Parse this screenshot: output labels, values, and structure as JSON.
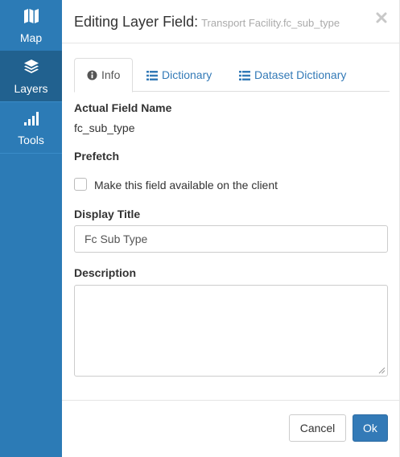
{
  "sidebar": {
    "items": [
      {
        "label": "Map",
        "icon": "map-icon"
      },
      {
        "label": "Layers",
        "icon": "layers-icon",
        "active": true
      },
      {
        "label": "Tools",
        "icon": "signal-bars-icon"
      }
    ]
  },
  "dialog": {
    "title": "Editing Layer Field:",
    "subtitle": "Transport Facility.fc_sub_type",
    "tabs": [
      {
        "label": "Info",
        "icon": "info-icon",
        "active": true
      },
      {
        "label": "Dictionary",
        "icon": "list-icon"
      },
      {
        "label": "Dataset Dictionary",
        "icon": "list-icon"
      }
    ],
    "actual_field_name": {
      "label": "Actual Field Name",
      "value": "fc_sub_type"
    },
    "prefetch": {
      "label": "Prefetch",
      "checkbox_label": "Make this field available on the client",
      "checked": false
    },
    "display_title": {
      "label": "Display Title",
      "value": "Fc Sub Type"
    },
    "description": {
      "label": "Description",
      "value": ""
    },
    "buttons": {
      "cancel": "Cancel",
      "ok": "Ok"
    }
  },
  "colors": {
    "sidebar": "#2c7bb6",
    "sidebar_active": "#21618f",
    "primary": "#337ab7",
    "link": "#337ab7"
  }
}
